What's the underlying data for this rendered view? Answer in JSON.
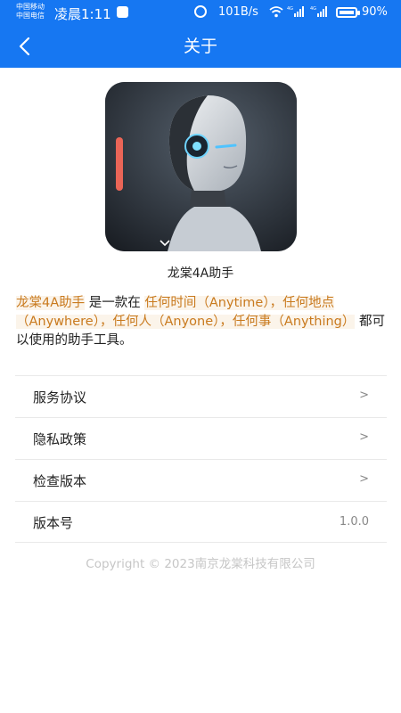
{
  "status_bar": {
    "carrier_1": "中国移动",
    "carrier_2": "中国电信",
    "time": "凌晨1:11",
    "net_speed": "101B/s",
    "battery_percent": "90%",
    "battery_level": 0.9,
    "signal_1_label": "4G",
    "signal_2_label": "4G",
    "icons": [
      "shield-icon",
      "alarm-icon",
      "wifi-icon",
      "signal-icon",
      "battery-icon"
    ]
  },
  "header": {
    "title": "关于",
    "back_icon": "chevron-left-icon",
    "background": "#1677f2"
  },
  "app": {
    "name": "龙棠4A助手",
    "logo_icon": "robot-head-logo"
  },
  "description": {
    "part1": "龙棠4A助手",
    "part2": " 是一款在 ",
    "part3": "任何时间（Anytime），任何地点（Anywhere），任何人（Anyone），任何事（Anything）",
    "part4": " 都可以使用的助手工具。",
    "highlight_color": "#c97a1e"
  },
  "menu": [
    {
      "label": "服务协议",
      "indicator": ">"
    },
    {
      "label": "隐私政策",
      "indicator": ">"
    },
    {
      "label": "检查版本",
      "indicator": ">"
    },
    {
      "label": "版本号",
      "indicator": "1.0.0"
    }
  ],
  "footer": {
    "copyright": "Copyright © 2023南京龙棠科技有限公司"
  }
}
